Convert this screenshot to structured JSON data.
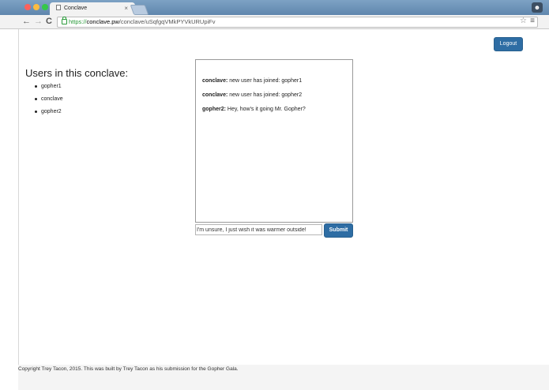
{
  "browser": {
    "tab_title": "Conclave",
    "tab_close": "×",
    "url_scheme": "https://",
    "url_host": "conclave.pw",
    "url_path": "/conclave/uSqfgqVMkPYVkURUpiFv",
    "nav_back": "←",
    "nav_forward": "→",
    "nav_reload": "C",
    "star": "☆",
    "menu": "≡",
    "user_icon": "☻",
    "icons": [
      "back-icon",
      "forward-icon",
      "reload-icon",
      "lock-icon",
      "star-icon",
      "menu-icon",
      "page-icon",
      "user-icon"
    ]
  },
  "header": {
    "logout_label": "Logout"
  },
  "users": {
    "title": "Users in this conclave:",
    "items": [
      "gopher1",
      "conclave",
      "gopher2"
    ]
  },
  "chat": {
    "messages": [
      {
        "sender": "conclave:",
        "text": " new user has joined: gopher1"
      },
      {
        "sender": "conclave:",
        "text": " new user has joined: gopher2"
      },
      {
        "sender": "gopher2:",
        "text": " Hey, how's it going Mr. Gopher?"
      }
    ],
    "input_value": "I'm unsure, I just wish it was warmer outside!",
    "submit_label": "Submit"
  },
  "footer": {
    "text": "Copyright Trey Tacon, 2015. This was built by Trey Tacon as his submission for the Gopher Gala."
  },
  "colors": {
    "primary_button": "#2e6da4",
    "titlebar": "#6d93b8",
    "secure_green": "#2a9a3a"
  }
}
